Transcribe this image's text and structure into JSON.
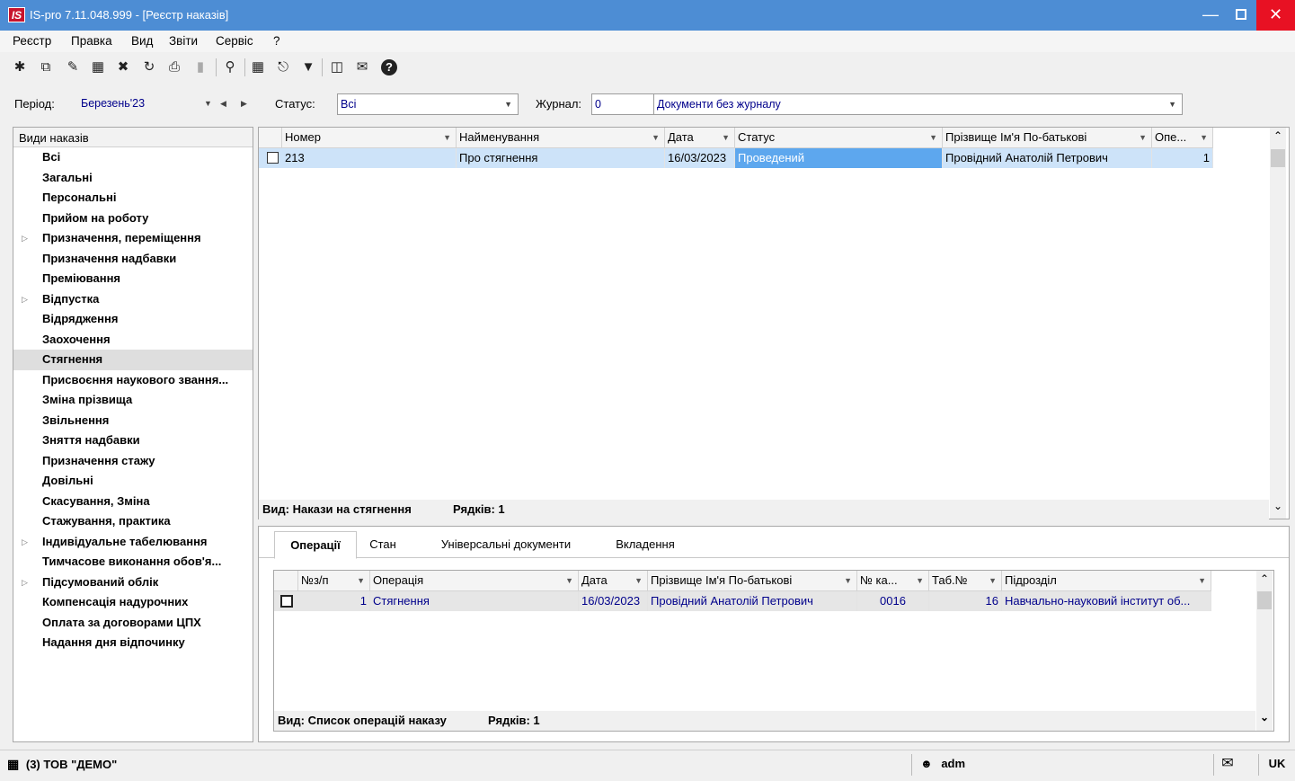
{
  "window": {
    "title": "IS-pro 7.11.048.999 - [Реєстр наказів]",
    "logo": "IS"
  },
  "menu": [
    "Реєстр",
    "Правка",
    "Вид",
    "Звіти",
    "Сервіс",
    "?"
  ],
  "toolbar_icons": [
    "new-doc-icon",
    "copy-icon",
    "edit-icon",
    "table-icon",
    "delete-icon",
    "refresh-icon",
    "print-icon",
    "export-icon",
    "search-icon",
    "grid-icon",
    "tree-icon",
    "filter-icon",
    "form-icon",
    "mail-icon",
    "help-icon"
  ],
  "filters": {
    "period_label": "Період:",
    "period_value": "Березень'23",
    "status_label": "Статус:",
    "status_value": "Всі",
    "journal_label": "Журнал:",
    "journal_code": "0",
    "journal_name": "Документи без журналу"
  },
  "left_panel": {
    "header": "Види наказів",
    "items": [
      {
        "label": "Всі",
        "expandable": false
      },
      {
        "label": "Загальні",
        "expandable": false
      },
      {
        "label": "Персональні",
        "expandable": false
      },
      {
        "label": "Прийом на роботу",
        "expandable": false
      },
      {
        "label": "Призначення, переміщення",
        "expandable": true
      },
      {
        "label": "Призначення надбавки",
        "expandable": false
      },
      {
        "label": "Преміювання",
        "expandable": false
      },
      {
        "label": "Відпустка",
        "expandable": true
      },
      {
        "label": "Відрядження",
        "expandable": false
      },
      {
        "label": "Заохочення",
        "expandable": false
      },
      {
        "label": "Стягнення",
        "expandable": false,
        "selected": true
      },
      {
        "label": "Присвоєння наукового звання...",
        "expandable": false
      },
      {
        "label": "Зміна прізвища",
        "expandable": false
      },
      {
        "label": "Звільнення",
        "expandable": false
      },
      {
        "label": "Зняття надбавки",
        "expandable": false
      },
      {
        "label": "Призначення стажу",
        "expandable": false
      },
      {
        "label": "Довільні",
        "expandable": false
      },
      {
        "label": "Скасування, Зміна",
        "expandable": false
      },
      {
        "label": "Стажування, практика",
        "expandable": false
      },
      {
        "label": "Індивідуальне табелювання",
        "expandable": true
      },
      {
        "label": "Тимчасове виконання обов'я...",
        "expandable": false
      },
      {
        "label": "Підсумований облік",
        "expandable": true
      },
      {
        "label": "Компенсація надурочних",
        "expandable": false
      },
      {
        "label": "Оплата за договорами ЦПХ",
        "expandable": false
      },
      {
        "label": "Надання дня відпочинку",
        "expandable": false
      }
    ]
  },
  "orders_grid": {
    "columns": [
      "Номер",
      "Найменування",
      "Дата",
      "Статус",
      "Прізвище Ім'я По-батькові",
      "Опе..."
    ],
    "rows": [
      {
        "number": "213",
        "name": "Про стягнення",
        "date": "16/03/2023",
        "status": "Проведений",
        "person": "Провідний Анатолій Петрович",
        "ops": "1"
      }
    ],
    "footer_view": "Вид: Накази на стягнення",
    "footer_rows": "Рядків: 1"
  },
  "bottom_tabs": [
    "Операції",
    "Стан",
    "Універсальні документи",
    "Вкладення"
  ],
  "operations_grid": {
    "columns": [
      "№з/п",
      "Операція",
      "Дата",
      "Прізвище Ім'я По-батькові",
      "№ ка...",
      "Таб.№",
      "Підрозділ"
    ],
    "rows": [
      {
        "n": "1",
        "operation": "Стягнення",
        "date": "16/03/2023",
        "person": "Провідний Анатолій Петрович",
        "card": "0016",
        "tab": "16",
        "department": "Навчально-науковий інститут об..."
      }
    ],
    "footer_view": "Вид: Список операцій наказу",
    "footer_rows": "Рядків: 1"
  },
  "statusbar": {
    "org": "(3) ТОВ \"ДЕМО\"",
    "user": "adm",
    "lang": "UK"
  }
}
